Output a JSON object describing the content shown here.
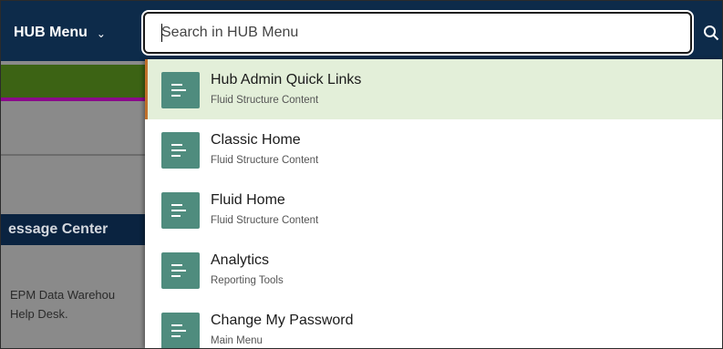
{
  "header": {
    "menu_label": "HUB Menu",
    "search_placeholder": "Search in HUB Menu"
  },
  "background": {
    "section_header": "essage Center",
    "text_lines": [
      "EPM Data Warehou",
      "Help Desk."
    ]
  },
  "dropdown": {
    "items": [
      {
        "title": "Hub Admin Quick Links",
        "subtitle": "Fluid Structure Content",
        "icon": "page-icon",
        "highlighted": true
      },
      {
        "title": "Classic Home",
        "subtitle": "Fluid Structure Content",
        "icon": "page-icon"
      },
      {
        "title": "Fluid Home",
        "subtitle": "Fluid Structure Content",
        "icon": "page-icon"
      },
      {
        "title": "Analytics",
        "subtitle": "Reporting Tools",
        "icon": "page-icon"
      },
      {
        "title": "Change My Password",
        "subtitle": "Main Menu",
        "icon": "page-icon"
      }
    ]
  },
  "colors": {
    "header_bg": "#0d2b4a",
    "icon_tile": "#4f8c7e",
    "highlight_row": "#e3efd9",
    "highlight_accent": "#c0702b"
  }
}
